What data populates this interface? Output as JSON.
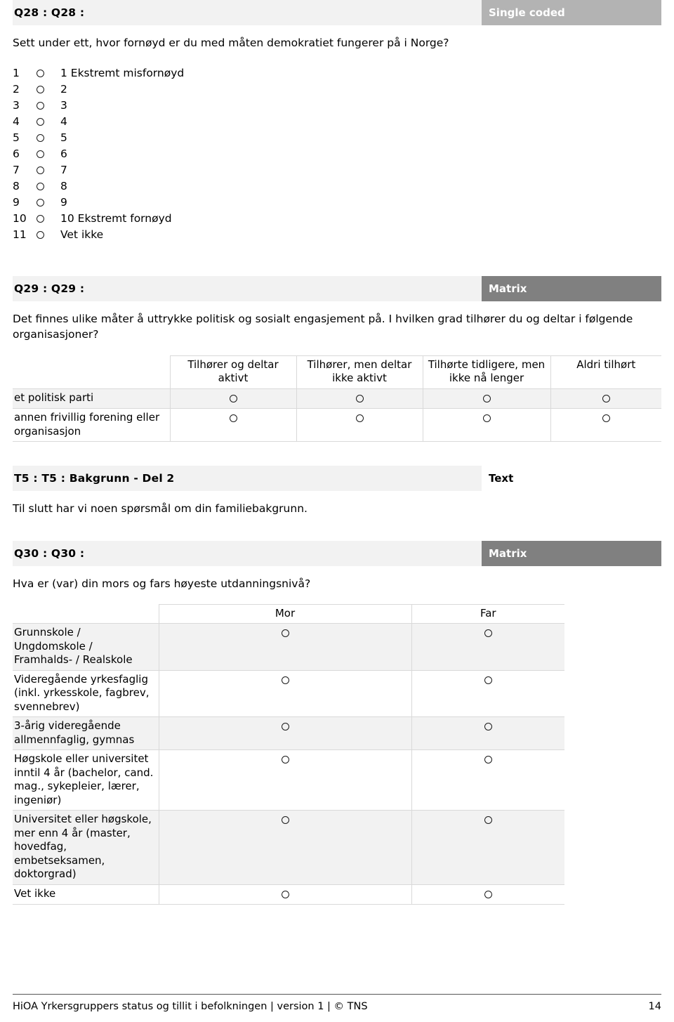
{
  "q28": {
    "title": "Q28 : Q28 :",
    "badge": "Single coded",
    "text": "Sett under ett, hvor fornøyd er du med måten demokratiet fungerer på i Norge?",
    "options": [
      {
        "num": "1",
        "label": "1 Ekstremt misfornøyd"
      },
      {
        "num": "2",
        "label": "2"
      },
      {
        "num": "3",
        "label": "3"
      },
      {
        "num": "4",
        "label": "4"
      },
      {
        "num": "5",
        "label": "5"
      },
      {
        "num": "6",
        "label": "6"
      },
      {
        "num": "7",
        "label": "7"
      },
      {
        "num": "8",
        "label": "8"
      },
      {
        "num": "9",
        "label": "9"
      },
      {
        "num": "10",
        "label": "10 Ekstremt fornøyd"
      },
      {
        "num": "11",
        "label": "Vet ikke"
      }
    ]
  },
  "q29": {
    "title": "Q29 : Q29 :",
    "badge": "Matrix",
    "text": "Det finnes ulike måter å uttrykke politisk og sosialt engasjement på. I hvilken grad tilhører du og deltar i følgende organisasjoner?",
    "columns": [
      "Tilhører og deltar aktivt",
      "Tilhører, men deltar ikke aktivt",
      "Tilhørte tidligere, men ikke nå lenger",
      "Aldri tilhørt"
    ],
    "rows": [
      "et politisk parti",
      "annen frivillig forening eller organisasjon"
    ]
  },
  "t5": {
    "title": "T5 : T5 : Bakgrunn - Del 2",
    "badge": "Text",
    "text": "Til slutt har vi noen spørsmål om din familiebakgrunn."
  },
  "q30": {
    "title": "Q30 : Q30 :",
    "badge": "Matrix",
    "text": "Hva er (var) din mors og fars høyeste utdanningsnivå?",
    "columns": [
      "Mor",
      "Far"
    ],
    "rows": [
      "Grunnskole / Ungdomskole / Framhalds- / Realskole",
      "Videregående yrkesfaglig (inkl. yrkesskole, fagbrev, svennebrev)",
      "3-årig videregående allmennfaglig, gymnas",
      "Høgskole eller universitet inntil 4 år (bachelor, cand. mag., sykepleier, lærer, ingeniør)",
      " Universitet eller høgskole, mer enn 4 år (master, hovedfag, embetseksamen, doktorgrad)",
      "Vet ikke"
    ]
  },
  "footer": {
    "left": "HiOA Yrkersgruppers status og tillit i befolkningen | version 1 | © TNS",
    "page": "14"
  },
  "colors": {
    "badge_single": "#b3b3b3",
    "badge_matrix": "#808080",
    "bar_background": "#f2f2f2",
    "row_shaded": "#f2f2f2",
    "border": "#d9d9d9"
  }
}
